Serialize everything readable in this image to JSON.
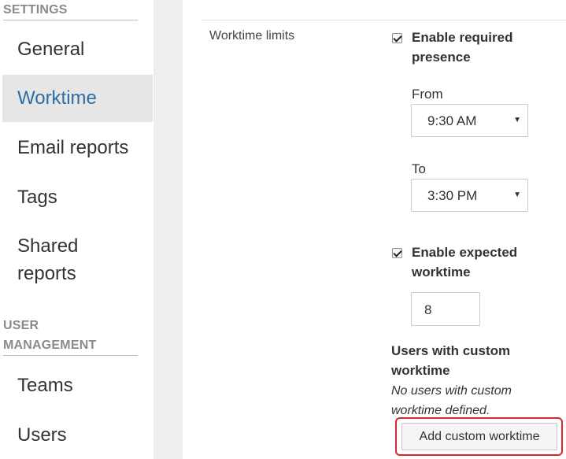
{
  "sidebar": {
    "settings_heading": "SETTINGS",
    "settings_items": [
      {
        "label": "General"
      },
      {
        "label": "Worktime"
      },
      {
        "label": "Email reports"
      },
      {
        "label": "Tags"
      },
      {
        "label": "Shared\nreports"
      }
    ],
    "active_item": "Worktime",
    "user_mgmt_heading": "USER\nMANAGEMENT",
    "user_mgmt_items": [
      {
        "label": "Teams"
      },
      {
        "label": "Users"
      }
    ]
  },
  "worktime": {
    "section_label": "Worktime limits",
    "required_presence": {
      "checked": true,
      "label": "Enable required\npresence",
      "from_label": "From",
      "from_value": "9:30 AM",
      "to_label": "To",
      "to_value": "3:30 PM"
    },
    "expected_worktime": {
      "checked": true,
      "label": "Enable expected\nworktime",
      "value": "8"
    },
    "custom": {
      "heading": "Users with custom\nworktime",
      "empty_note": "No users with custom\nworktime defined.",
      "add_button_label": "Add custom worktime"
    }
  },
  "colors": {
    "active_nav_text": "#2f6da3",
    "active_nav_bg": "#e6e6e6",
    "highlight_border": "#d8282f"
  },
  "icons": {
    "select_caret": "triangle-down"
  }
}
